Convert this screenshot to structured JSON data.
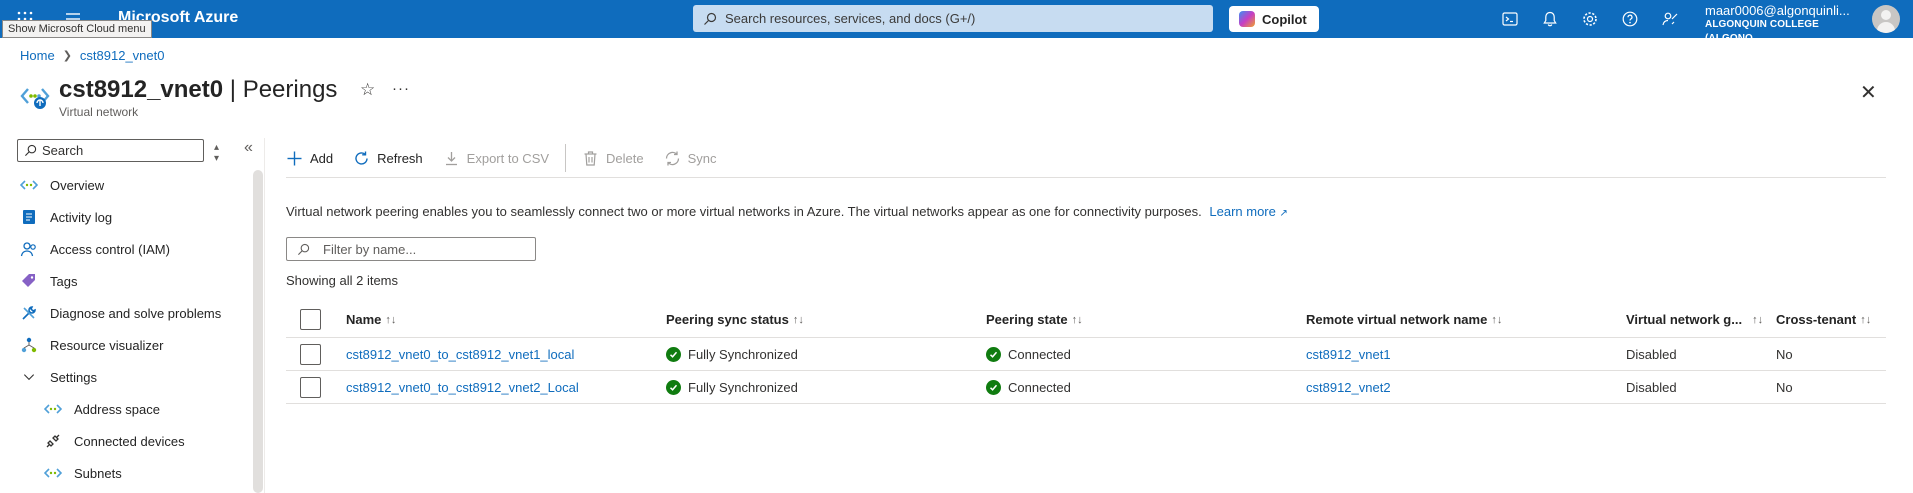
{
  "topbar": {
    "brand": "Microsoft Azure",
    "tooltip": "Show Microsoft Cloud menu",
    "search_placeholder": "Search resources, services, and docs (G+/)",
    "copilot_label": "Copilot",
    "user_email": "maar0006@algonquinli...",
    "user_org": "ALGONQUIN COLLEGE (ALGONQ..."
  },
  "breadcrumb": {
    "home": "Home",
    "resource": "cst8912_vnet0"
  },
  "header": {
    "resource_name": "cst8912_vnet0",
    "section": "| Peerings",
    "resource_type": "Virtual network"
  },
  "nav": {
    "search_placeholder": "Search",
    "items": [
      {
        "label": "Overview",
        "icon": "overview-icon"
      },
      {
        "label": "Activity log",
        "icon": "activity-log-icon"
      },
      {
        "label": "Access control (IAM)",
        "icon": "iam-icon"
      },
      {
        "label": "Tags",
        "icon": "tag-icon"
      },
      {
        "label": "Diagnose and solve problems",
        "icon": "diagnose-icon"
      },
      {
        "label": "Resource visualizer",
        "icon": "visualizer-icon"
      },
      {
        "label": "Settings",
        "icon": "chevron-down-icon"
      },
      {
        "label": "Address space",
        "icon": "address-space-icon"
      },
      {
        "label": "Connected devices",
        "icon": "plug-icon"
      },
      {
        "label": "Subnets",
        "icon": "subnets-icon"
      }
    ]
  },
  "toolbar": {
    "add": "Add",
    "refresh": "Refresh",
    "export": "Export to CSV",
    "delete": "Delete",
    "sync": "Sync"
  },
  "info": {
    "text": "Virtual network peering enables you to seamlessly connect two or more virtual networks in Azure. The virtual networks appear as one for connectivity purposes.",
    "learn_more": "Learn more"
  },
  "filter_placeholder": "Filter by name...",
  "count_text": "Showing all 2 items",
  "table": {
    "columns": [
      "Name",
      "Peering sync status",
      "Peering state",
      "Remote virtual network name",
      "Virtual network g...",
      "Cross-tenant"
    ],
    "rows": [
      {
        "name": "cst8912_vnet0_to_cst8912_vnet1_local",
        "sync": "Fully Synchronized",
        "state": "Connected",
        "remote": "cst8912_vnet1",
        "gateway": "Disabled",
        "cross": "No"
      },
      {
        "name": "cst8912_vnet0_to_cst8912_vnet2_Local",
        "sync": "Fully Synchronized",
        "state": "Connected",
        "remote": "cst8912_vnet2",
        "gateway": "Disabled",
        "cross": "No"
      }
    ]
  },
  "colors": {
    "accent": "#0f6cbd",
    "success": "#107c10"
  }
}
